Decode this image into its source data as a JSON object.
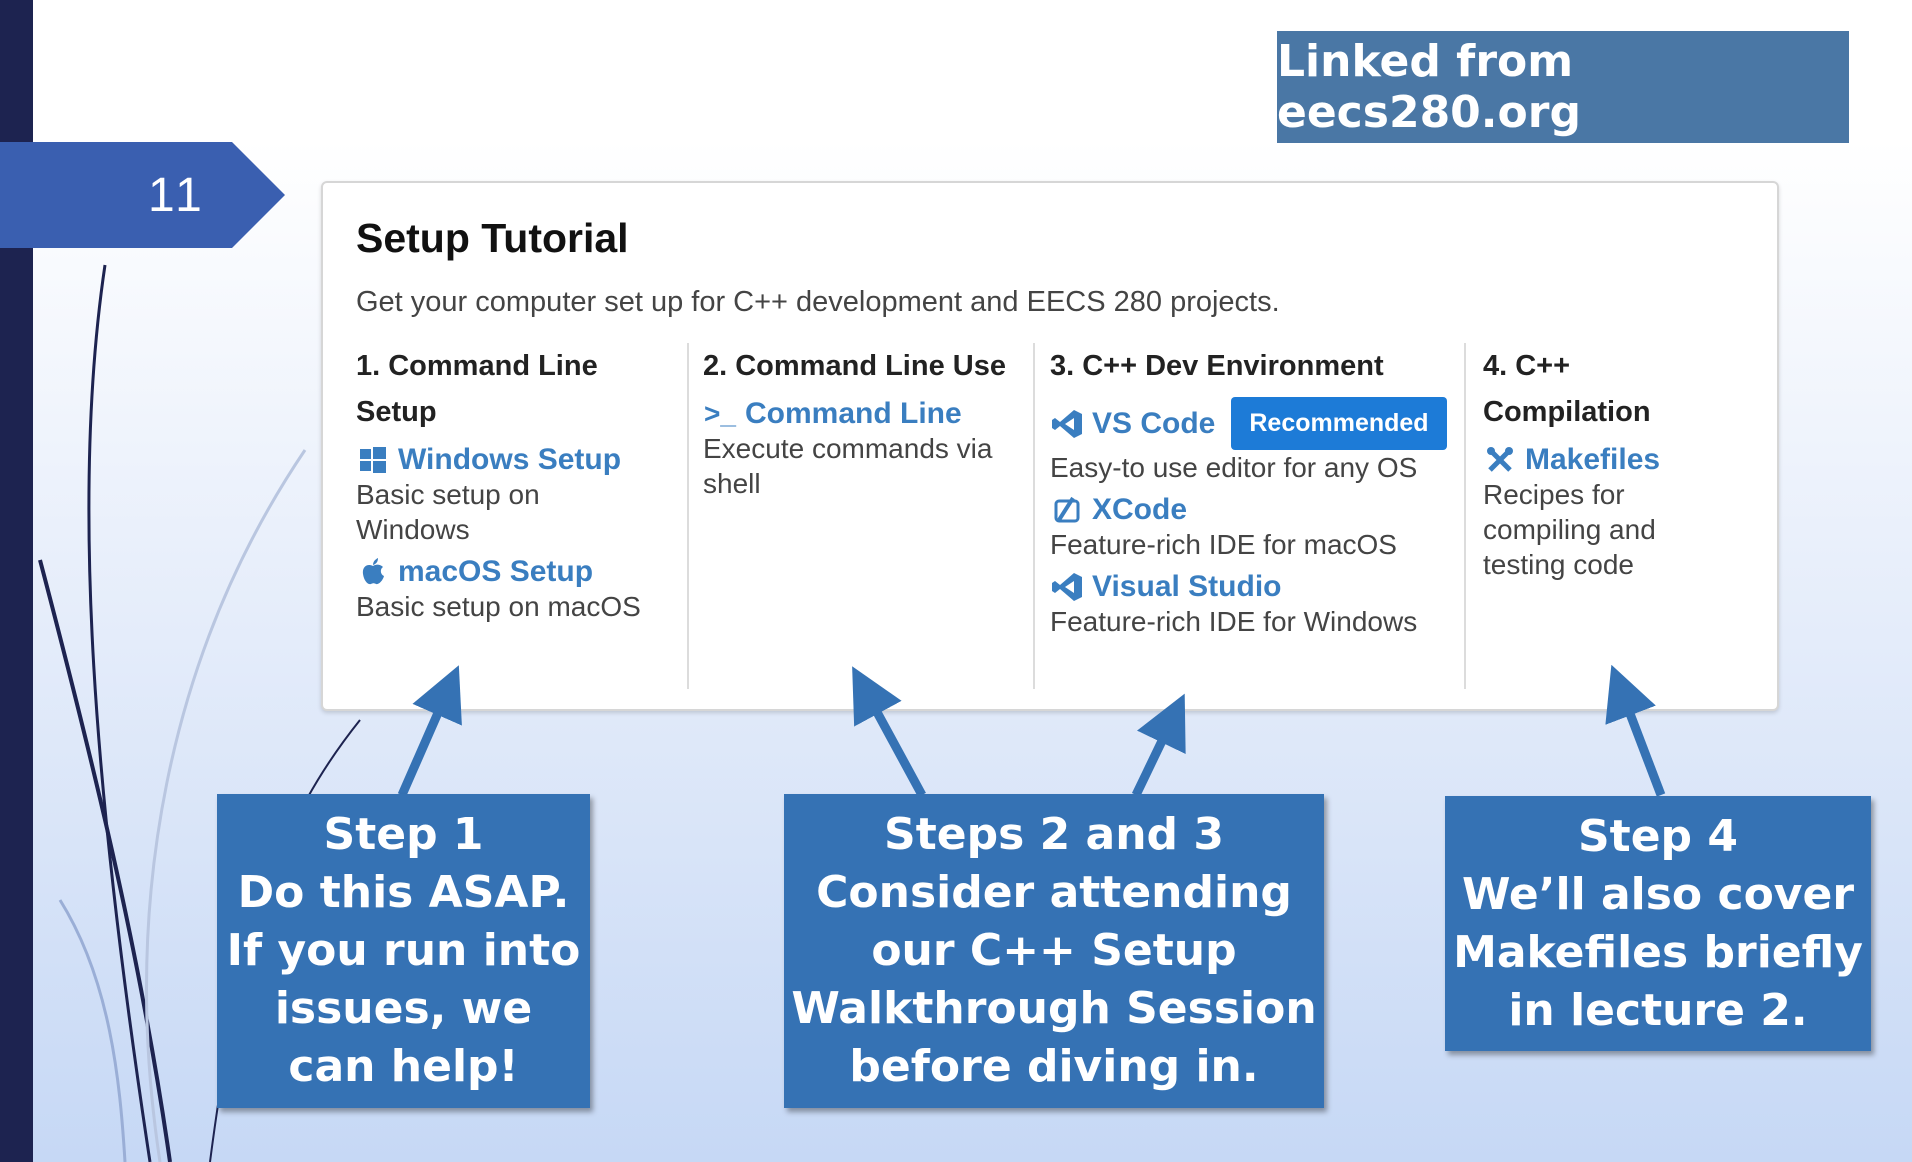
{
  "slide": {
    "number": "11"
  },
  "linked_label": "Linked from eecs280.org",
  "tutorial": {
    "title": "Setup Tutorial",
    "subtitle": "Get your computer set up for C++ development and EECS 280 projects.",
    "columns": [
      {
        "heading_line1": "1. Command Line",
        "heading_line2": "Setup",
        "links": [
          {
            "icon": "windows-icon",
            "label": "Windows Setup",
            "desc_line1": "Basic setup on",
            "desc_line2": "Windows"
          },
          {
            "icon": "apple-icon",
            "label": "macOS Setup",
            "desc_line1": "Basic setup on macOS"
          }
        ]
      },
      {
        "heading_line1": "2. Command Line Use",
        "links": [
          {
            "icon": "terminal-icon",
            "label": "Command Line",
            "desc_line1": "Execute commands via",
            "desc_line2": "shell"
          }
        ]
      },
      {
        "heading_line1": "3. C++ Dev Environment",
        "links": [
          {
            "icon": "vscode-icon",
            "label": "VS Code",
            "badge": "Recommended",
            "desc_line1": "Easy-to use editor for any OS"
          },
          {
            "icon": "xcode-icon",
            "label": "XCode",
            "desc_line1": "Feature-rich IDE for macOS"
          },
          {
            "icon": "visual-studio-icon",
            "label": "Visual Studio",
            "desc_line1": "Feature-rich IDE for Windows"
          }
        ]
      },
      {
        "heading_line1": "4. C++",
        "heading_line2": "Compilation",
        "links": [
          {
            "icon": "tools-icon",
            "label": "Makefiles",
            "desc_line1": "Recipes for",
            "desc_line2": "compiling and",
            "desc_line3": "testing code"
          }
        ]
      }
    ]
  },
  "callouts": [
    {
      "lines": [
        "Step 1",
        "Do this ASAP.",
        "If you run into",
        "issues, we",
        "can help!"
      ]
    },
    {
      "lines": [
        "Steps 2 and 3",
        "Consider attending",
        "our C++ Setup",
        "Walkthrough Session",
        "before diving in."
      ]
    },
    {
      "lines": [
        "Step 4",
        "We’ll also cover",
        "Makefiles briefly",
        "in lecture 2."
      ]
    }
  ],
  "colors": {
    "dark_bar": "#1d2350",
    "tab": "#3a5fb0",
    "callout": "#3572b4",
    "link": "#3a7ec0",
    "badge": "#1d7bd7"
  }
}
